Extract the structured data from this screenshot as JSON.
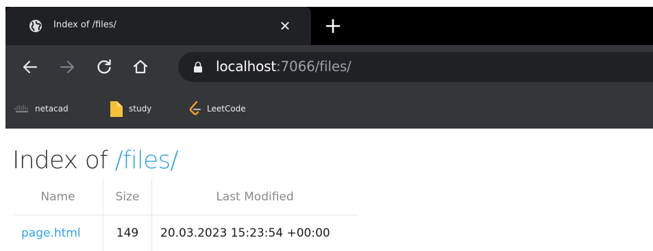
{
  "tab": {
    "title": "Index of /files/",
    "close_symbol": "✕"
  },
  "toolbar": {
    "url_host": "localhost",
    "url_rest": ":7066/files/"
  },
  "bookmarks": [
    {
      "label": "netacad",
      "icon": "cisco-icon"
    },
    {
      "label": "study",
      "icon": "folder-icon"
    },
    {
      "label": "LeetCode",
      "icon": "leetcode-icon"
    }
  ],
  "page": {
    "title_prefix": "Index of ",
    "title_path": "/files/",
    "columns": [
      "Name",
      "Size",
      "Last Modified"
    ],
    "rows": [
      {
        "name": "page.html",
        "size": "149",
        "modified": "20.03.2023 15:23:54 +00:00"
      }
    ]
  },
  "colors": {
    "tab_bg": "#202124",
    "toolbar_bg": "#35363a",
    "link": "#2fa4e7",
    "folder": "#f8c03a",
    "leetcode": "#ffa116"
  }
}
